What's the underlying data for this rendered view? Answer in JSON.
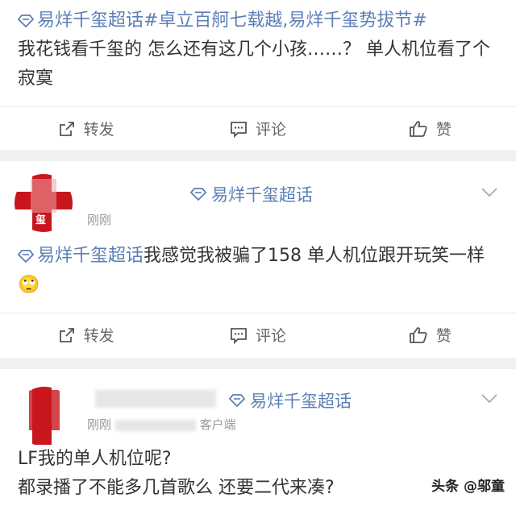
{
  "post1": {
    "tag_text": "易烊千玺超话#卓立百舸七载越,易烊千玺势拔节#",
    "text": "我花钱看千玺的 怎么还有这几个小孩……？ 单人机位看了个寂寞",
    "actions": {
      "repost": "转发",
      "comment": "评论",
      "like": "赞"
    }
  },
  "post2": {
    "group": "易烊千玺超话",
    "time": "刚刚",
    "tag_text": "易烊千玺超话",
    "text": "我感觉我被骗了158 单人机位跟开玩笑一样🙄",
    "actions": {
      "repost": "转发",
      "comment": "评论",
      "like": "赞"
    }
  },
  "post3": {
    "group": "易烊千玺超话",
    "time_prefix": "刚刚",
    "time_suffix": "客户端",
    "line1": "LF我的单人机位呢?",
    "line2": "都录播了不能多几首歌么  还要二代来凑?"
  },
  "watermark": "头条 @邬童",
  "colors": {
    "link": "#5b7fb5",
    "separator": "#eef0f2",
    "avatar_red": "#c8161d"
  },
  "icons": {
    "repost": "share-icon",
    "comment": "comment-icon",
    "like": "thumbs-up-icon",
    "chevron": "chevron-down-icon",
    "tag": "diamond-icon"
  }
}
